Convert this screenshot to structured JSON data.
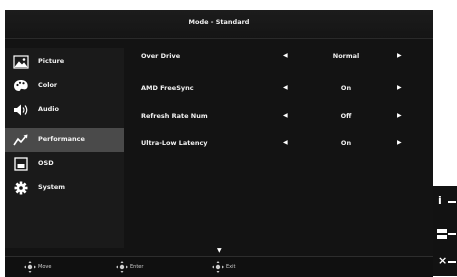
{
  "title": "Mode - Standard",
  "sidebar": {
    "items": [
      {
        "label": "Picture",
        "icon": "picture-icon"
      },
      {
        "label": "Color",
        "icon": "color-palette-icon"
      },
      {
        "label": "Audio",
        "icon": "speaker-icon"
      },
      {
        "label": "Performance",
        "icon": "performance-icon",
        "active": true
      },
      {
        "label": "OSD",
        "icon": "osd-icon"
      },
      {
        "label": "System",
        "icon": "gear-icon"
      }
    ]
  },
  "settings": [
    {
      "label": "Over Drive",
      "value": "Normal"
    },
    {
      "label": "AMD FreeSync",
      "value": "On"
    },
    {
      "label": "Refresh Rate Num",
      "value": "Off"
    },
    {
      "label": "Ultra-Low Latency",
      "value": "On"
    }
  ],
  "footer": {
    "move": "Move",
    "enter": "Enter",
    "exit": "Exit"
  },
  "side_keys": {
    "info": "i",
    "menu": "menu-icon",
    "close": "×"
  }
}
